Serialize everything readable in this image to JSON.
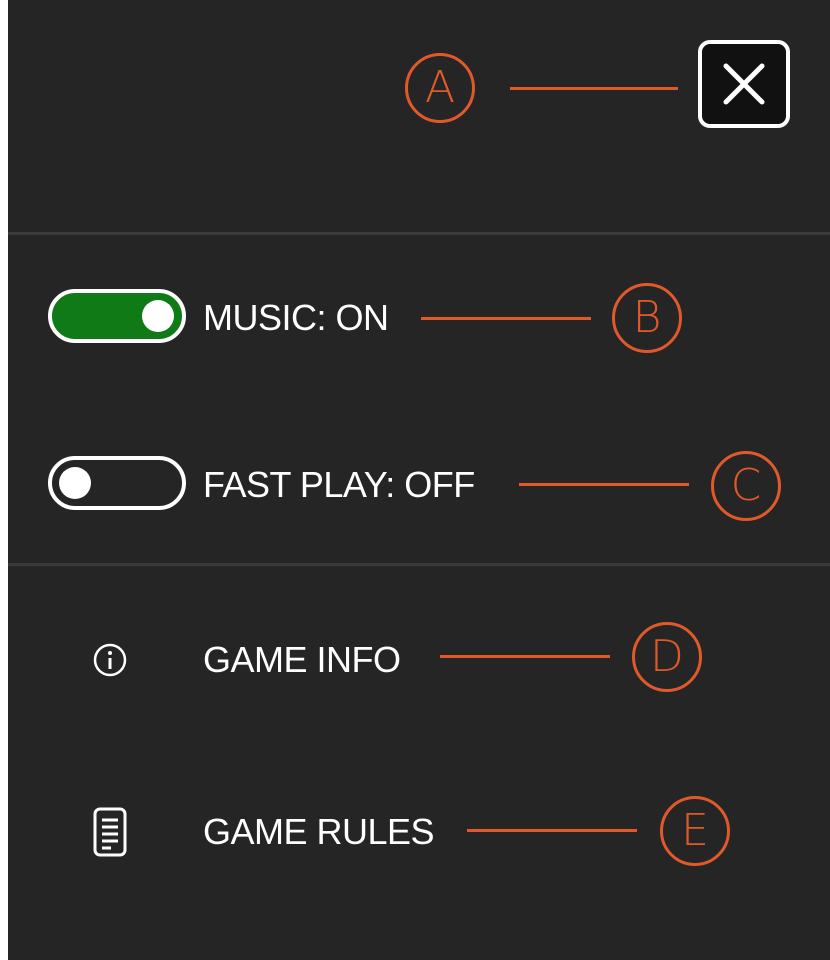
{
  "settings": {
    "close_label": "Close",
    "music": {
      "label": "MUSIC: ON",
      "on": true,
      "track_color": "#0f7a16"
    },
    "fast_play": {
      "label": "FAST PLAY: OFF",
      "on": false,
      "track_color": "#252525"
    }
  },
  "menu": {
    "game_info": {
      "label": "GAME INFO",
      "icon": "info-icon"
    },
    "game_rules": {
      "label": "GAME RULES",
      "icon": "document-icon"
    }
  },
  "callouts": [
    "A",
    "B",
    "C",
    "D",
    "E"
  ],
  "colors": {
    "background": "#252525",
    "accent": "#e0592a",
    "toggle_on": "#0f7a16",
    "text": "#ffffff"
  }
}
